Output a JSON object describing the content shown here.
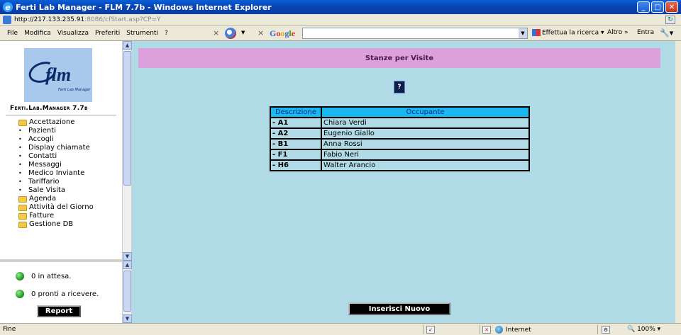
{
  "window": {
    "title": "Ferti Lab Manager - FLM 7.7b - Windows Internet Explorer",
    "address_host": "http://217.133.235.91",
    "address_path": ":8086/cfStart.asp?CP=Y"
  },
  "menu": {
    "items": [
      "File",
      "Modifica",
      "Visualizza",
      "Preferiti",
      "Strumenti",
      "?"
    ]
  },
  "toolbar": {
    "google_label": "Google",
    "search_label": "Effettua la ricerca",
    "more_label": "Altro »",
    "login_label": "Entra"
  },
  "sidebar": {
    "app_name": "Ferti.Lab.Manager 7.7b",
    "logo_text": "flm",
    "logo_sub": "Ferti Lab Manager",
    "nav": [
      {
        "label": "Accettazione",
        "type": "folder"
      },
      {
        "label": "Pazienti",
        "type": "item"
      },
      {
        "label": "Accogli",
        "type": "item"
      },
      {
        "label": "Display chiamate",
        "type": "item"
      },
      {
        "label": "Contatti",
        "type": "item"
      },
      {
        "label": "Messaggi",
        "type": "item"
      },
      {
        "label": "Medico Inviante",
        "type": "item"
      },
      {
        "label": "Tariffario",
        "type": "item"
      },
      {
        "label": "Sale Visita",
        "type": "item"
      },
      {
        "label": "Agenda",
        "type": "folder"
      },
      {
        "label": "Attività del Giorno",
        "type": "folder"
      },
      {
        "label": "Fatture",
        "type": "folder"
      },
      {
        "label": "Gestione DB",
        "type": "folder"
      }
    ]
  },
  "status_panel": {
    "waiting": "0 in attesa.",
    "ready": "0 pronti a ricevere.",
    "report_label": "Report"
  },
  "main": {
    "header_title": "Stanze per Visite",
    "help_label": "?",
    "table": {
      "headers": [
        "Descrizione",
        "Occupante"
      ],
      "rows": [
        {
          "code": "- A1",
          "occupant": "Chiara Verdi"
        },
        {
          "code": "- A2",
          "occupant": "Eugenio Giallo"
        },
        {
          "code": "- B1",
          "occupant": "Anna Rossi"
        },
        {
          "code": "- F1",
          "occupant": "Fabio Neri"
        },
        {
          "code": "- H6",
          "occupant": "Walter Arancio"
        }
      ]
    },
    "new_button_label": "Inserisci Nuovo"
  },
  "statusbar": {
    "left_text": "Fine",
    "zone": "Internet",
    "zoom": "100%"
  },
  "colors": {
    "header_bg": "#dca0dc",
    "content_bg": "#b0dbe6",
    "table_header_bg": "#1ab8f0"
  }
}
